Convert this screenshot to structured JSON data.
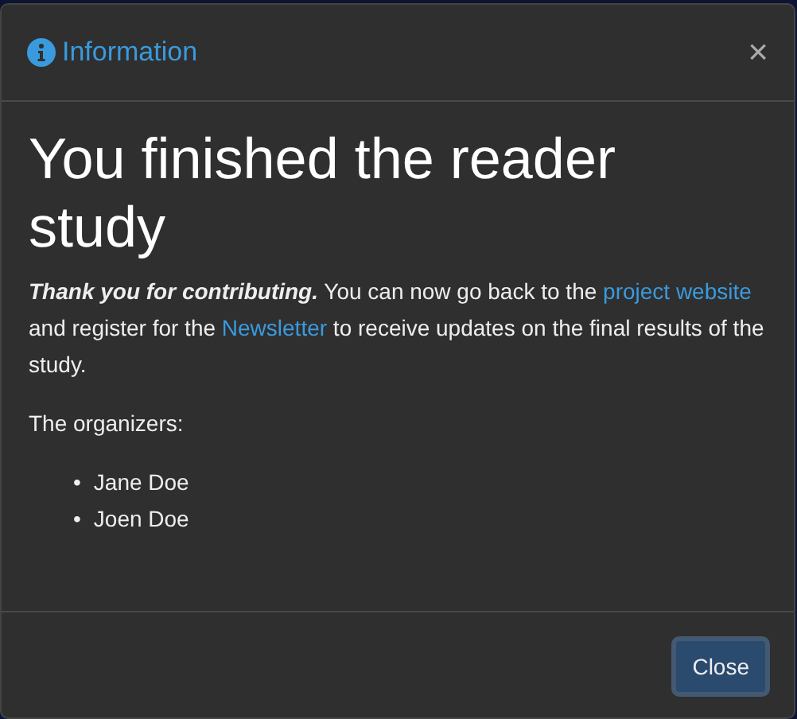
{
  "dialog": {
    "title": "Information",
    "close_glyph": "×",
    "heading": "You finished the reader study",
    "message": [
      {
        "kind": "strong",
        "text": "Thank you for contributing."
      },
      {
        "kind": "text",
        "text": " You can now go back to the "
      },
      {
        "kind": "link",
        "text": "project website"
      },
      {
        "kind": "text",
        "text": " and register for the "
      },
      {
        "kind": "link",
        "text": "Newsletter"
      },
      {
        "kind": "text",
        "text": " to receive updates on the final results of the study."
      }
    ],
    "signoff": "The organizers:",
    "organizers": [
      {
        "bullet": "•",
        "name": "Jane Doe"
      },
      {
        "bullet": "•",
        "name": "Joen Doe"
      }
    ],
    "buttons": [
      "Close"
    ]
  }
}
